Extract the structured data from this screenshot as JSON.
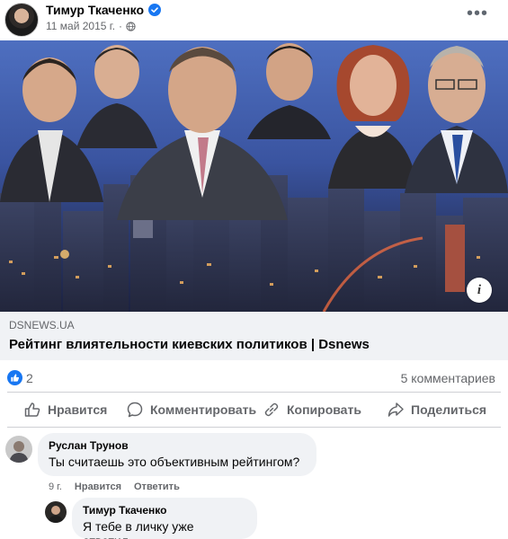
{
  "post": {
    "author": "Тимур Ткаченко",
    "date": "11 май 2015 г.",
    "separator": "·",
    "more": "•••"
  },
  "link": {
    "domain": "DSNEWS.UA",
    "title": "Рейтинг влиятельности киевских политиков | Dsnews",
    "info": "i"
  },
  "reactions": {
    "count": "2",
    "comments": "5 комментариев"
  },
  "actions": {
    "like": "Нравится",
    "comment": "Комментировать",
    "copy": "Копировать",
    "share": "Поделиться"
  },
  "comments": [
    {
      "author": "Руслан Трунов",
      "text": "Ты считаешь это объективным рейтингом?",
      "age": "9 г.",
      "like": "Нравится",
      "reply": "Ответить"
    },
    {
      "author": "Тимур Ткаченко",
      "text": "Я тебе в личку уже ответил."
    }
  ],
  "colors": {
    "accent": "#1877f2",
    "secondary_text": "#65676b",
    "bubble": "#f0f2f5"
  }
}
